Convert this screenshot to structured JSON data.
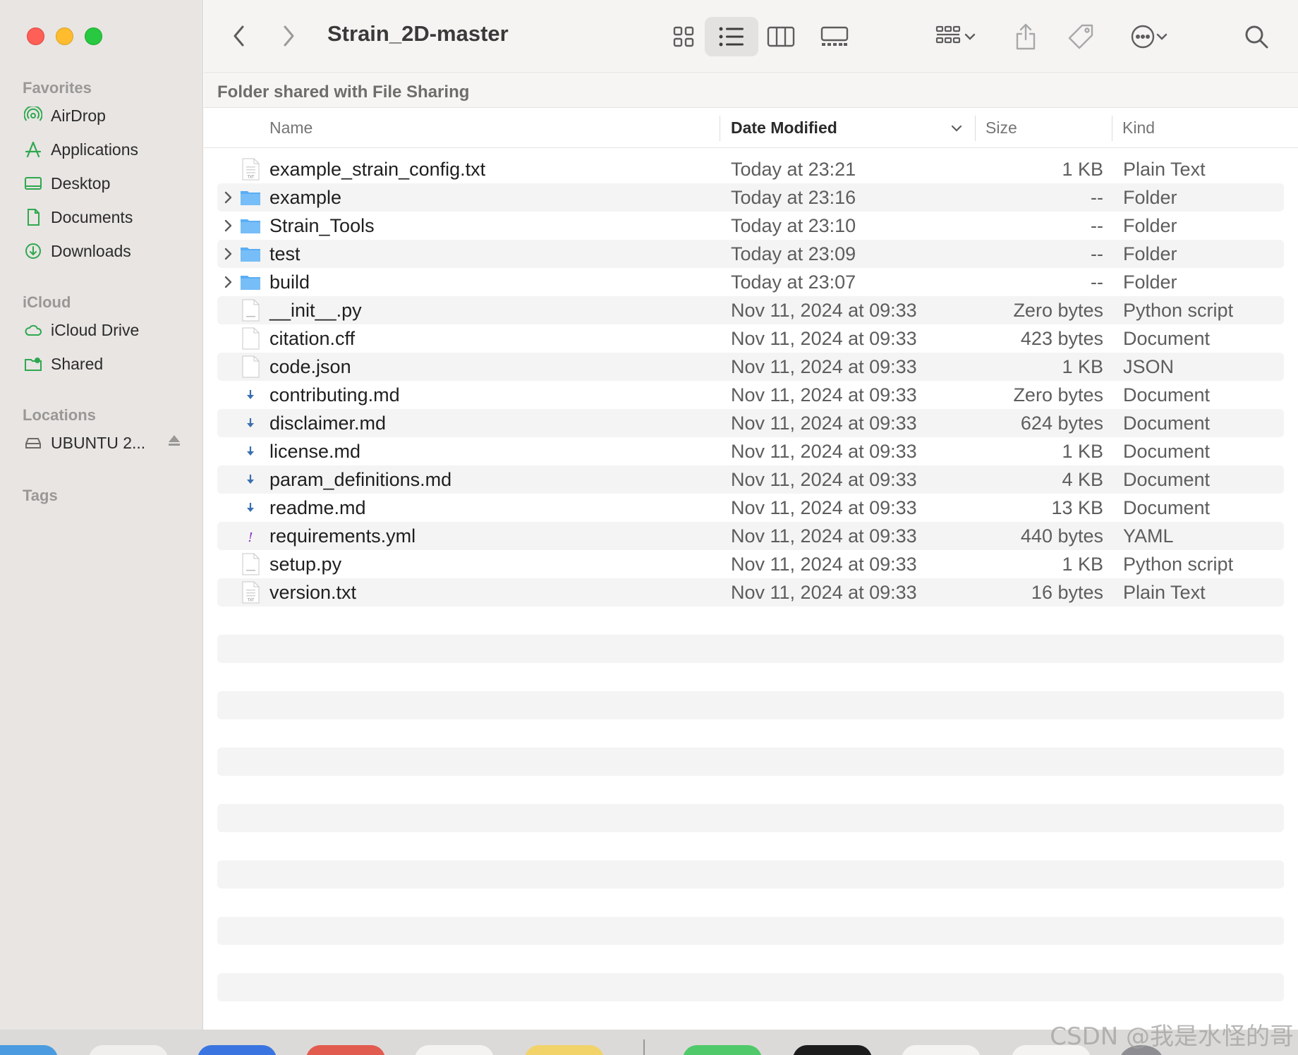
{
  "window": {
    "title": "Strain_2D-master",
    "path_bar": "Folder shared with File Sharing"
  },
  "sidebar": {
    "sections": [
      {
        "label": "Favorites",
        "items": [
          {
            "label": "AirDrop",
            "icon": "airdrop-icon"
          },
          {
            "label": "Applications",
            "icon": "applications-icon"
          },
          {
            "label": "Desktop",
            "icon": "desktop-icon"
          },
          {
            "label": "Documents",
            "icon": "document-icon"
          },
          {
            "label": "Downloads",
            "icon": "downloads-icon"
          }
        ]
      },
      {
        "label": "iCloud",
        "items": [
          {
            "label": "iCloud Drive",
            "icon": "cloud-icon"
          },
          {
            "label": "Shared",
            "icon": "shared-folder-icon"
          }
        ]
      },
      {
        "label": "Locations",
        "items": [
          {
            "label": "UBUNTU 2...",
            "icon": "drive-icon"
          }
        ]
      },
      {
        "label": "Tags",
        "items": []
      }
    ]
  },
  "columns": {
    "name": "Name",
    "date": "Date Modified",
    "size": "Size",
    "kind": "Kind"
  },
  "files": [
    {
      "name": "example_strain_config.txt",
      "date": "Today at 23:21",
      "size": "1 KB",
      "kind": "Plain Text",
      "icon": "txt"
    },
    {
      "name": "example",
      "date": "Today at 23:16",
      "size": "--",
      "kind": "Folder",
      "icon": "folder"
    },
    {
      "name": "Strain_Tools",
      "date": "Today at 23:10",
      "size": "--",
      "kind": "Folder",
      "icon": "folder"
    },
    {
      "name": "test",
      "date": "Today at 23:09",
      "size": "--",
      "kind": "Folder",
      "icon": "folder"
    },
    {
      "name": "build",
      "date": "Today at 23:07",
      "size": "--",
      "kind": "Folder",
      "icon": "folder"
    },
    {
      "name": "__init__.py",
      "date": "Nov 11, 2024 at 09:33",
      "size": "Zero bytes",
      "kind": "Python script",
      "icon": "py"
    },
    {
      "name": "citation.cff",
      "date": "Nov 11, 2024 at 09:33",
      "size": "423 bytes",
      "kind": "Document",
      "icon": "blank"
    },
    {
      "name": "code.json",
      "date": "Nov 11, 2024 at 09:33",
      "size": "1 KB",
      "kind": "JSON",
      "icon": "blank"
    },
    {
      "name": "contributing.md",
      "date": "Nov 11, 2024 at 09:33",
      "size": "Zero bytes",
      "kind": "Document",
      "icon": "md"
    },
    {
      "name": "disclaimer.md",
      "date": "Nov 11, 2024 at 09:33",
      "size": "624 bytes",
      "kind": "Document",
      "icon": "md"
    },
    {
      "name": "license.md",
      "date": "Nov 11, 2024 at 09:33",
      "size": "1 KB",
      "kind": "Document",
      "icon": "md"
    },
    {
      "name": "param_definitions.md",
      "date": "Nov 11, 2024 at 09:33",
      "size": "4 KB",
      "kind": "Document",
      "icon": "md"
    },
    {
      "name": "readme.md",
      "date": "Nov 11, 2024 at 09:33",
      "size": "13 KB",
      "kind": "Document",
      "icon": "md"
    },
    {
      "name": "requirements.yml",
      "date": "Nov 11, 2024 at 09:33",
      "size": "440 bytes",
      "kind": "YAML",
      "icon": "yml"
    },
    {
      "name": "setup.py",
      "date": "Nov 11, 2024 at 09:33",
      "size": "1 KB",
      "kind": "Python script",
      "icon": "py"
    },
    {
      "name": "version.txt",
      "date": "Nov 11, 2024 at 09:33",
      "size": "16 bytes",
      "kind": "Plain Text",
      "icon": "txt"
    }
  ],
  "watermark": "CSDN @我是水怪的哥",
  "colors": {
    "sidebar_bg": "#e8e5e3",
    "folder": "#5aaef5",
    "accent": "#1f6fe5"
  }
}
